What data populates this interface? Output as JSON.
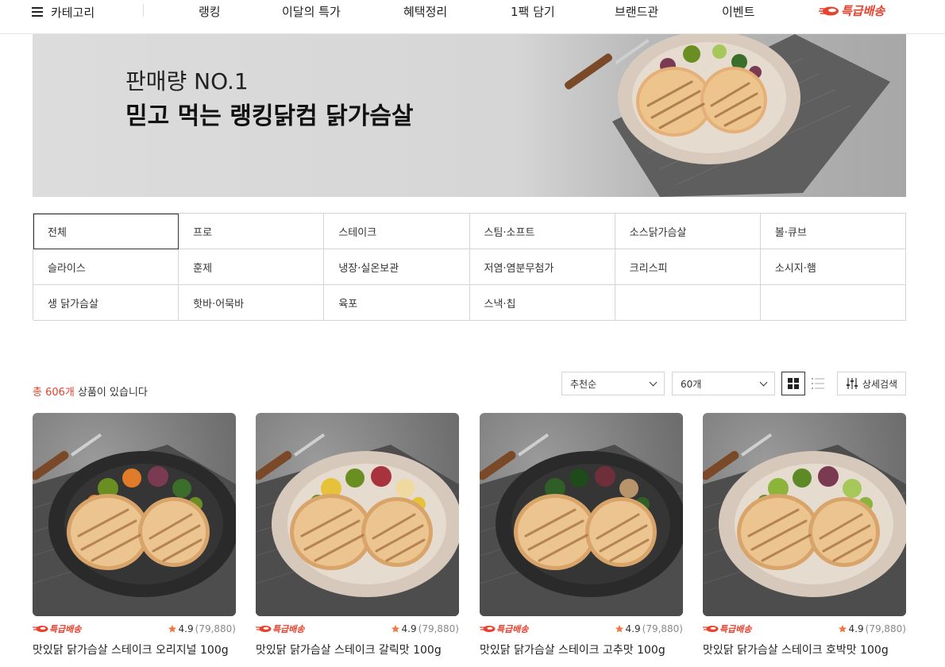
{
  "nav": {
    "category_label": "카테고리",
    "items": [
      "랭킹",
      "이달의 특가",
      "혜택정리",
      "1팩 담기",
      "브랜드관",
      "이벤트"
    ],
    "express_label": "특급배송"
  },
  "banner": {
    "subtitle": "판매량 NO.1",
    "title": "믿고 먹는 랭킹닭컴 닭가슴살"
  },
  "categories": [
    "전체",
    "프로",
    "스테이크",
    "스팀·소프트",
    "소스닭가슴살",
    "볼·큐브",
    "슬라이스",
    "훈제",
    "냉장·실온보관",
    "저염·염분무첨가",
    "크리스피",
    "소시지·햄",
    "생 닭가슴살",
    "핫바·어묵바",
    "육포",
    "스낵·칩",
    "",
    ""
  ],
  "categories_active": "전체",
  "toolbar": {
    "count_prefix": "총 606개",
    "count_suffix": " 상품이 있습니다",
    "sort_selected": "추천순",
    "per_page_selected": "60개",
    "detail_search": "상세검색"
  },
  "products": [
    {
      "badge": "특급배송",
      "rating": "4.9",
      "reviews": "(79,880)",
      "name": "맛있닭 닭가슴살 스테이크 오리지널 100g",
      "plate": "dark",
      "garnish": [
        "#6b8e23",
        "#e07b2a",
        "#7a3b52",
        "#3b6e2a"
      ]
    },
    {
      "badge": "특급배송",
      "rating": "4.9",
      "reviews": "(79,880)",
      "name": "맛있닭 닭가슴살 스테이크 갈릭맛 100g",
      "plate": "light",
      "garnish": [
        "#e6c23a",
        "#6b8e23",
        "#a8323e",
        "#f0d9a0"
      ]
    },
    {
      "badge": "특급배송",
      "rating": "4.9",
      "reviews": "(79,880)",
      "name": "맛있닭 닭가슴살 스테이크 고추맛 100g",
      "plate": "dark",
      "garnish": [
        "#2f5e26",
        "#1f4a1c",
        "#6e2f3a",
        "#b8946a"
      ]
    },
    {
      "badge": "특급배송",
      "rating": "4.9",
      "reviews": "(79,880)",
      "name": "맛있닭 닭가슴살 스테이크 호박맛 100g",
      "plate": "light",
      "garnish": [
        "#8cb33a",
        "#5e8a25",
        "#7a3b52",
        "#a6c85a"
      ]
    }
  ],
  "colors": {
    "accent": "#e8412c",
    "star": "#f07a45"
  }
}
